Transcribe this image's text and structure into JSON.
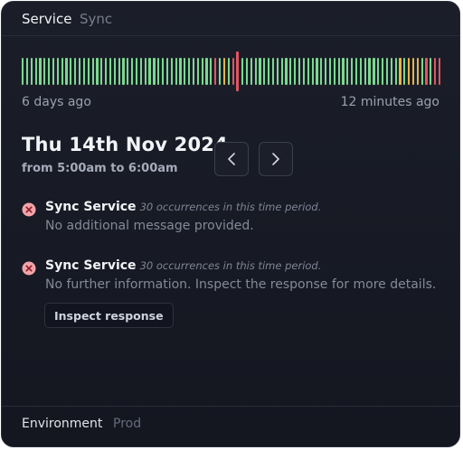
{
  "header": {
    "label": "Service",
    "value": "Sync"
  },
  "timeline": {
    "start_label": "6 days ago",
    "end_label": "12 minutes ago",
    "bars": [
      "ok",
      "ok",
      "ok",
      "ok",
      "ok",
      "ok",
      "ok",
      "ok",
      "ok",
      "ok",
      "ok",
      "ok",
      "ok",
      "ok",
      "ok",
      "ok",
      "ok",
      "ok",
      "ok",
      "ok",
      "ok",
      "ok",
      "ok",
      "ok",
      "ok",
      "ok",
      "ok",
      "ok",
      "ok",
      "ok",
      "ok",
      "ok",
      "ok",
      "ok",
      "ok",
      "ok",
      "ok",
      "ok",
      "ok",
      "ok",
      "ok",
      "ok",
      "ok",
      "ok",
      "err",
      "ok",
      "warn",
      "ok",
      "err",
      "sel",
      "ok",
      "ok",
      "ok",
      "ok",
      "ok",
      "ok",
      "ok",
      "ok",
      "ok",
      "ok",
      "ok",
      "ok",
      "ok",
      "ok",
      "ok",
      "ok",
      "ok",
      "ok",
      "ok",
      "ok",
      "ok",
      "ok",
      "ok",
      "ok",
      "ok",
      "ok",
      "ok",
      "ok",
      "ok",
      "ok",
      "ok",
      "ok",
      "ok",
      "ok",
      "ok",
      "ok",
      "warn",
      "ok",
      "warn",
      "warn",
      "warn",
      "ok",
      "err",
      "ok",
      "err",
      "err"
    ],
    "colors": {
      "ok": "#7bd88f",
      "warn": "#e6b34a",
      "err": "#e05561"
    }
  },
  "period": {
    "date": "Thu 14th Nov 2024",
    "time": "from 5:00am to 6:00am"
  },
  "nav": {
    "prev_icon": "chevron-left-icon",
    "next_icon": "chevron-right-icon"
  },
  "events": [
    {
      "icon": "error-x-icon",
      "title": "Sync Service",
      "count": "30 occurrences in this time period.",
      "message": "No additional message provided."
    },
    {
      "icon": "error-x-icon",
      "title": "Sync Service",
      "count": "30 occurrences in this time period.",
      "message": "No further information. Inspect the response for more details."
    }
  ],
  "inspect_button": "Inspect response",
  "footer": {
    "label": "Environment",
    "value": "Prod"
  }
}
